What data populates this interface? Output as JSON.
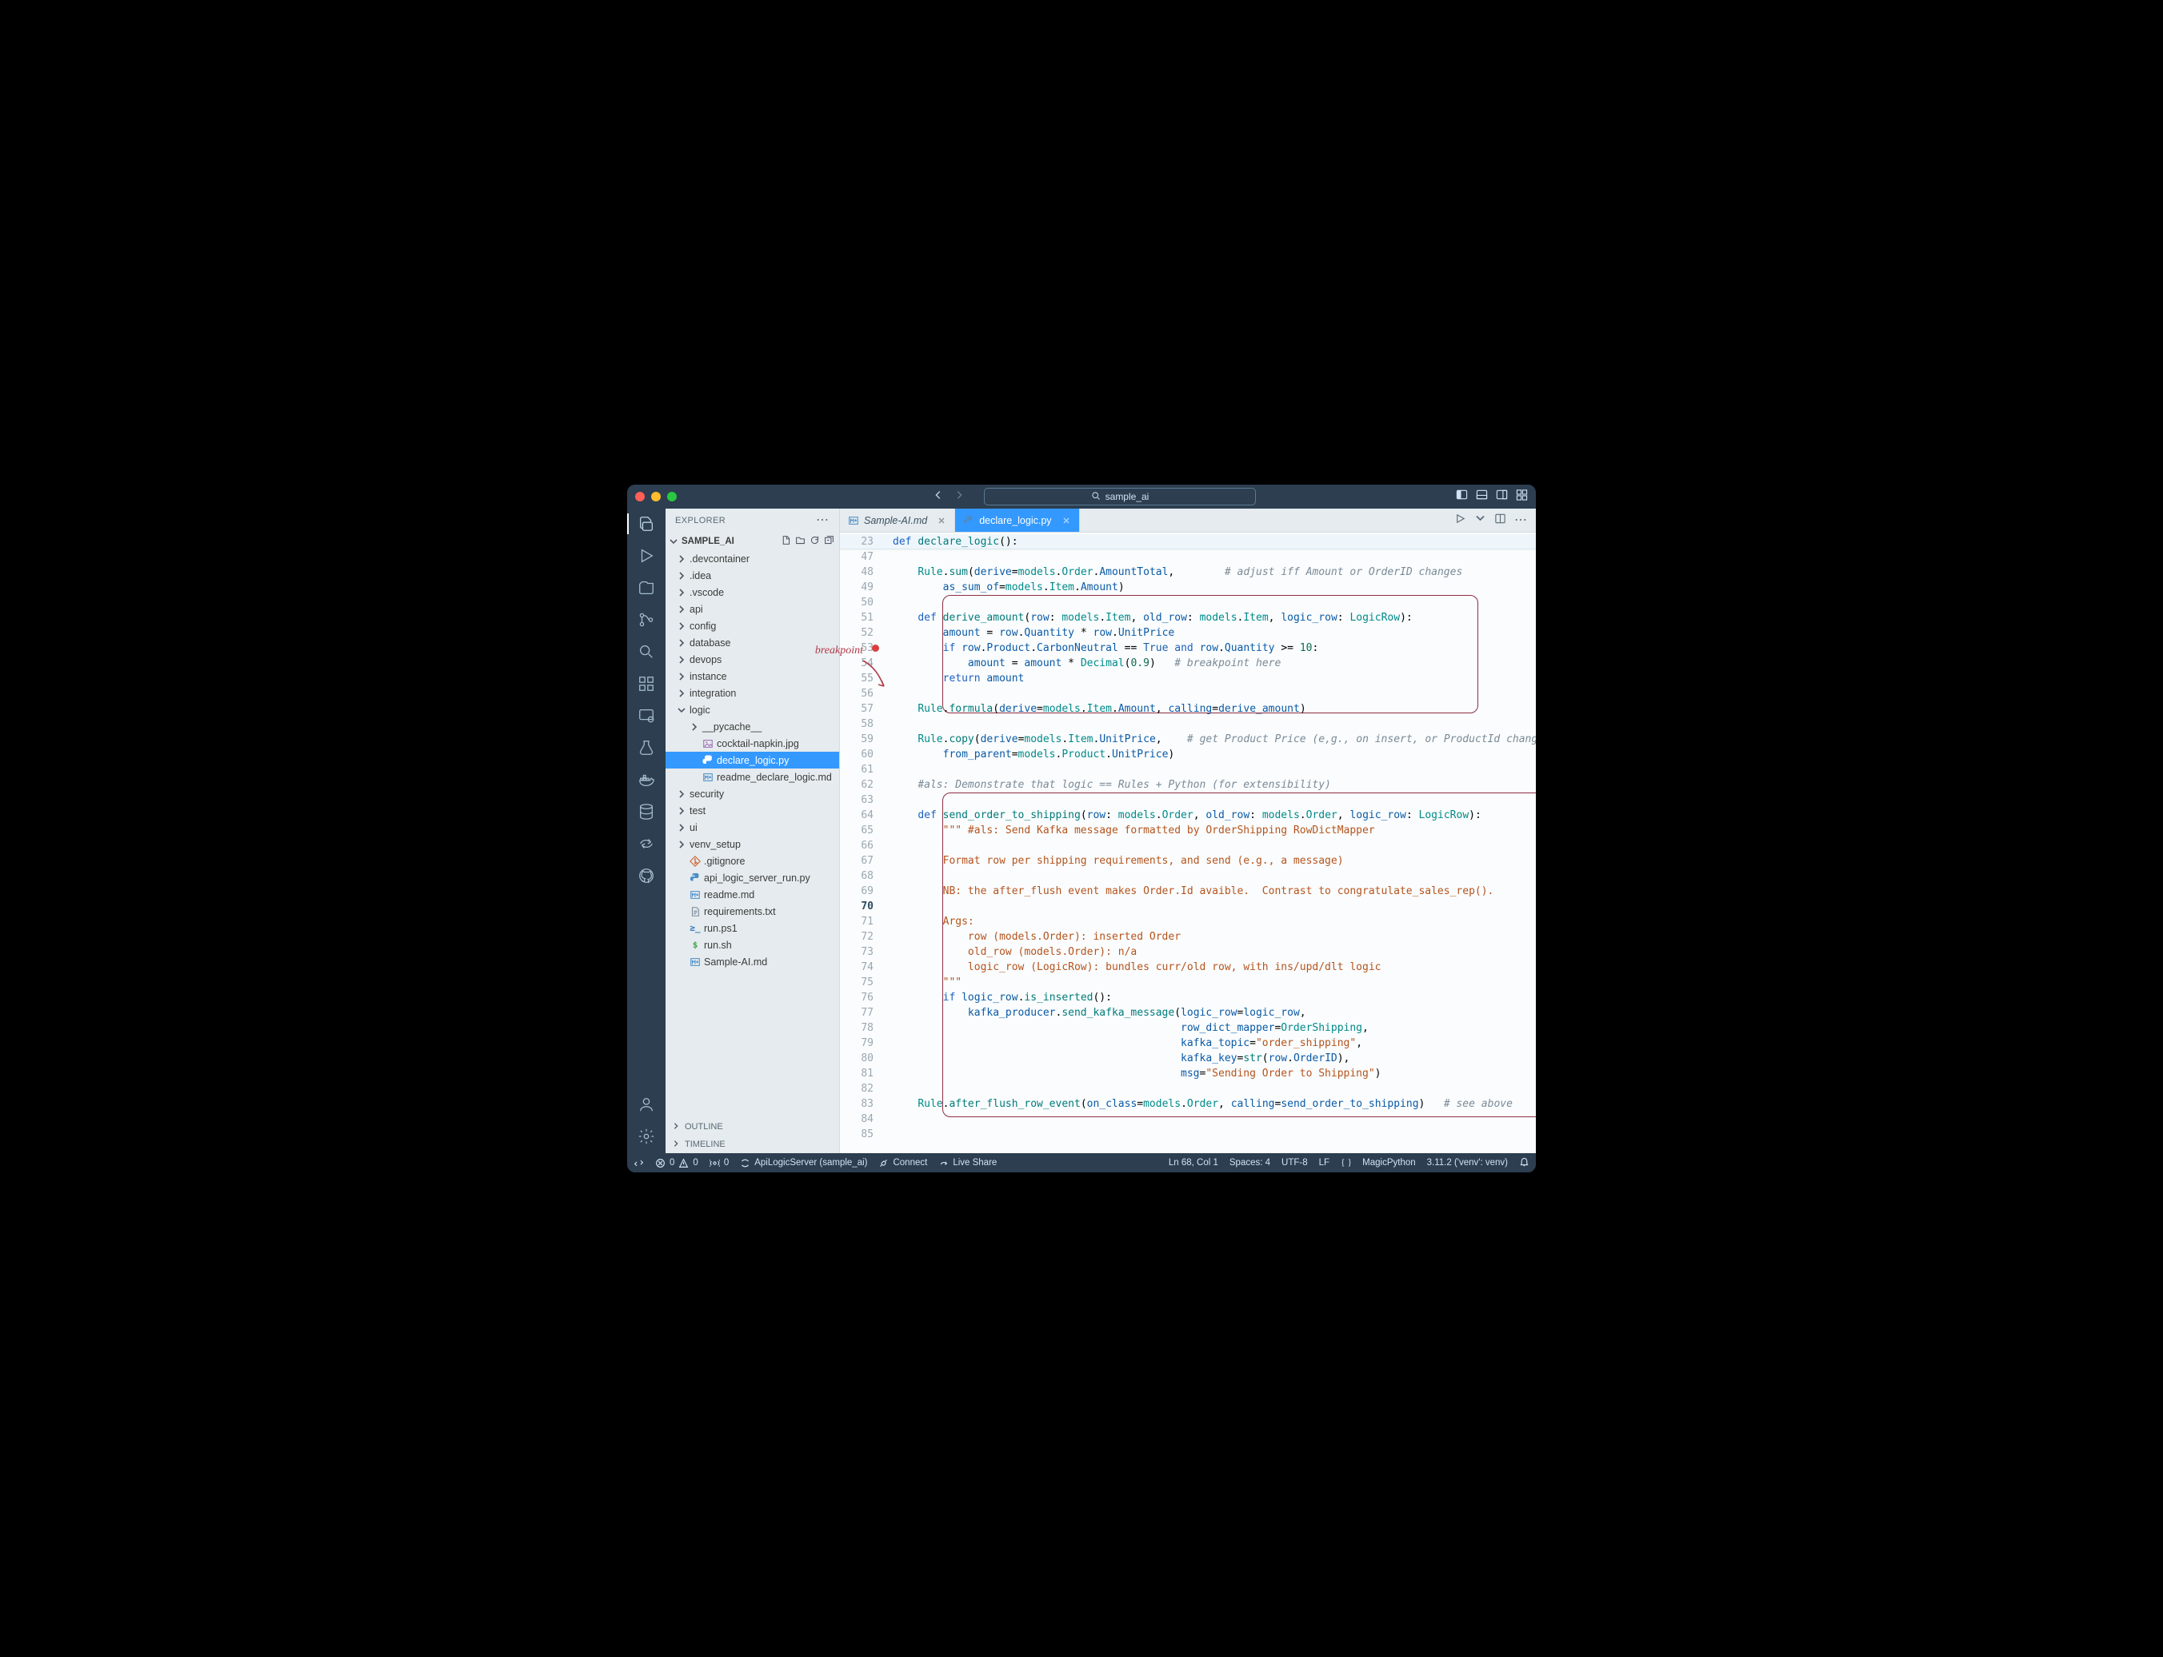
{
  "window": {
    "title": "sample_ai"
  },
  "sidebar": {
    "header": "EXPLORER",
    "root": "SAMPLE_AI",
    "outline": "OUTLINE",
    "timeline": "TIMELINE",
    "annotation": "breakpoint",
    "items": [
      {
        "label": ".devcontainer",
        "kind": "folder",
        "depth": 1,
        "expanded": false
      },
      {
        "label": ".idea",
        "kind": "folder",
        "depth": 1,
        "expanded": false
      },
      {
        "label": ".vscode",
        "kind": "folder",
        "depth": 1,
        "expanded": false
      },
      {
        "label": "api",
        "kind": "folder",
        "depth": 1,
        "expanded": false
      },
      {
        "label": "config",
        "kind": "folder",
        "depth": 1,
        "expanded": false
      },
      {
        "label": "database",
        "kind": "folder",
        "depth": 1,
        "expanded": false
      },
      {
        "label": "devops",
        "kind": "folder",
        "depth": 1,
        "expanded": false
      },
      {
        "label": "instance",
        "kind": "folder",
        "depth": 1,
        "expanded": false
      },
      {
        "label": "integration",
        "kind": "folder",
        "depth": 1,
        "expanded": false
      },
      {
        "label": "logic",
        "kind": "folder",
        "depth": 1,
        "expanded": true
      },
      {
        "label": "__pycache__",
        "kind": "folder",
        "depth": 2,
        "expanded": false
      },
      {
        "label": "cocktail-napkin.jpg",
        "kind": "image",
        "depth": 2
      },
      {
        "label": "declare_logic.py",
        "kind": "python",
        "depth": 2,
        "selected": true
      },
      {
        "label": "readme_declare_logic.md",
        "kind": "markdown",
        "depth": 2
      },
      {
        "label": "security",
        "kind": "folder",
        "depth": 1,
        "expanded": false
      },
      {
        "label": "test",
        "kind": "folder",
        "depth": 1,
        "expanded": false
      },
      {
        "label": "ui",
        "kind": "folder",
        "depth": 1,
        "expanded": false
      },
      {
        "label": "venv_setup",
        "kind": "folder",
        "depth": 1,
        "expanded": false
      },
      {
        "label": ".gitignore",
        "kind": "git",
        "depth": 1
      },
      {
        "label": "api_logic_server_run.py",
        "kind": "python",
        "depth": 1
      },
      {
        "label": "readme.md",
        "kind": "markdown",
        "depth": 1
      },
      {
        "label": "requirements.txt",
        "kind": "text",
        "depth": 1
      },
      {
        "label": "run.ps1",
        "kind": "ps",
        "depth": 1
      },
      {
        "label": "run.sh",
        "kind": "sh",
        "depth": 1
      },
      {
        "label": "Sample-AI.md",
        "kind": "markdown",
        "depth": 1
      }
    ]
  },
  "tabs": [
    {
      "label": "Sample-AI.md",
      "kind": "markdown",
      "active": false,
      "preview": true
    },
    {
      "label": "declare_logic.py",
      "kind": "python",
      "active": true
    }
  ],
  "editor": {
    "first_line": 23,
    "sticky_line": 23,
    "current_line_index": 24,
    "gutter": [
      "23",
      "47",
      "48",
      "49",
      "50",
      "51",
      "52",
      "53",
      "54",
      "55",
      "56",
      "57",
      "58",
      "59",
      "60",
      "61",
      "62",
      "63",
      "64",
      "65",
      "66",
      "67",
      "68",
      "69",
      "70",
      "71",
      "72",
      "73",
      "74",
      "75",
      "76",
      "77",
      "78",
      "79",
      "80",
      "81",
      "82",
      "83",
      "84",
      "85"
    ],
    "breakpoint_at": "53"
  },
  "status": {
    "remote": "",
    "errors": "0",
    "warnings": "0",
    "ports": "0",
    "venv": "ApiLogicServer (sample_ai)",
    "connect": "Connect",
    "liveshare": "Live Share",
    "cursor": "Ln 68, Col 1",
    "spaces": "Spaces: 4",
    "encoding": "UTF-8",
    "eol": "LF",
    "lang": "MagicPython",
    "py_interp": "3.11.2 ('venv': venv)"
  },
  "code_tokens": {
    "def": "def",
    "declare_logic": "declare_logic",
    "Rule": "Rule",
    "sum": "sum",
    "derive": "derive",
    "models": "models",
    "Order": "Order",
    "AmountTotal": "AmountTotal",
    "cmt_adjust": "# adjust iff Amount or OrderID changes",
    "as_sum_of": "as_sum_of",
    "Item": "Item",
    "Amount": "Amount",
    "derive_amount": "derive_amount",
    "row": "row",
    "old_row": "old_row",
    "logic_row": "logic_row",
    "LogicRow": "LogicRow",
    "amount": "amount",
    "Quantity": "Quantity",
    "UnitPrice": "UnitPrice",
    "if": "if",
    "Product": "Product",
    "CarbonNeutral": "CarbonNeutral",
    "True": "True",
    "and": "and",
    "ge10": ">= ",
    "ten": "10",
    "Decimal": "Decimal",
    "p09": "0.9",
    "cmt_bp": "# breakpoint here",
    "return": "return",
    "formula": "formula",
    "calling": "calling",
    "copy": "copy",
    "cmt_getprod": "# get Product Price (e,g., on insert, or ProductId change)",
    "from_parent": "from_parent",
    "cmt_als": "#als: Demonstrate that logic == Rules + Python (for extensibility)",
    "send_order": "send_order_to_shipping",
    "doc1": "\"\"\" #als: Send Kafka message formatted by OrderShipping RowDictMapper",
    "doc2": "Format row per shipping requirements, and send (e.g., a message)",
    "doc3": "NB: the after_flush event makes Order.Id avaible.  Contrast to congratulate_sales_rep().",
    "doc_args": "Args:",
    "doc_row": "    row (models.Order): inserted Order",
    "doc_old": "    old_row (models.Order): n/a",
    "doc_lr": "    logic_row (LogicRow): bundles curr/old row, with ins/upd/dlt logic",
    "doc_end": "\"\"\"",
    "is_inserted": "is_inserted",
    "kafka_producer": "kafka_producer",
    "send_kafka_message": "send_kafka_message",
    "row_dict_mapper": "row_dict_mapper",
    "OrderShipping": "OrderShipping",
    "kafka_topic": "kafka_topic",
    "topic_val": "\"order_shipping\"",
    "kafka_key": "kafka_key",
    "str": "str",
    "OrderID": "OrderID",
    "msg": "msg",
    "msg_val": "\"Sending Order to Shipping\"",
    "after_flush": "after_flush_row_event",
    "on_class": "on_class",
    "cmt_see": "# see above"
  }
}
